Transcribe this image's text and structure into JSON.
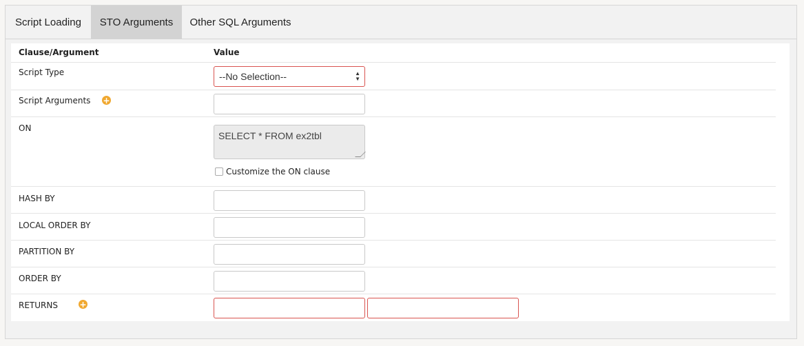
{
  "tabs": [
    {
      "label": "Script Loading"
    },
    {
      "label": "STO Arguments"
    },
    {
      "label": "Other SQL Arguments"
    }
  ],
  "table": {
    "header_clause": "Clause/Argument",
    "header_value": "Value"
  },
  "rows": {
    "script_type": {
      "label": "Script Type",
      "selected": "--No Selection--"
    },
    "script_arguments": {
      "label": "Script Arguments",
      "value": ""
    },
    "on": {
      "label": "ON",
      "value": "SELECT * FROM ex2tbl",
      "customize_label": "Customize the ON clause"
    },
    "hash_by": {
      "label": "HASH BY",
      "value": ""
    },
    "local_order_by": {
      "label": "LOCAL ORDER BY",
      "value": ""
    },
    "partition_by": {
      "label": "PARTITION BY",
      "value": ""
    },
    "order_by": {
      "label": "ORDER BY",
      "value": ""
    },
    "returns": {
      "label": "RETURNS",
      "name_value": "",
      "type_value": ""
    }
  },
  "colors": {
    "accent_plus": "#f0a830",
    "error_border": "#d9534f",
    "active_tab": "#d3d3d3"
  },
  "icons": {
    "add": "plus-circle-icon",
    "select_arrows": "sort-arrows-icon",
    "resize": "resize-grip-icon"
  }
}
